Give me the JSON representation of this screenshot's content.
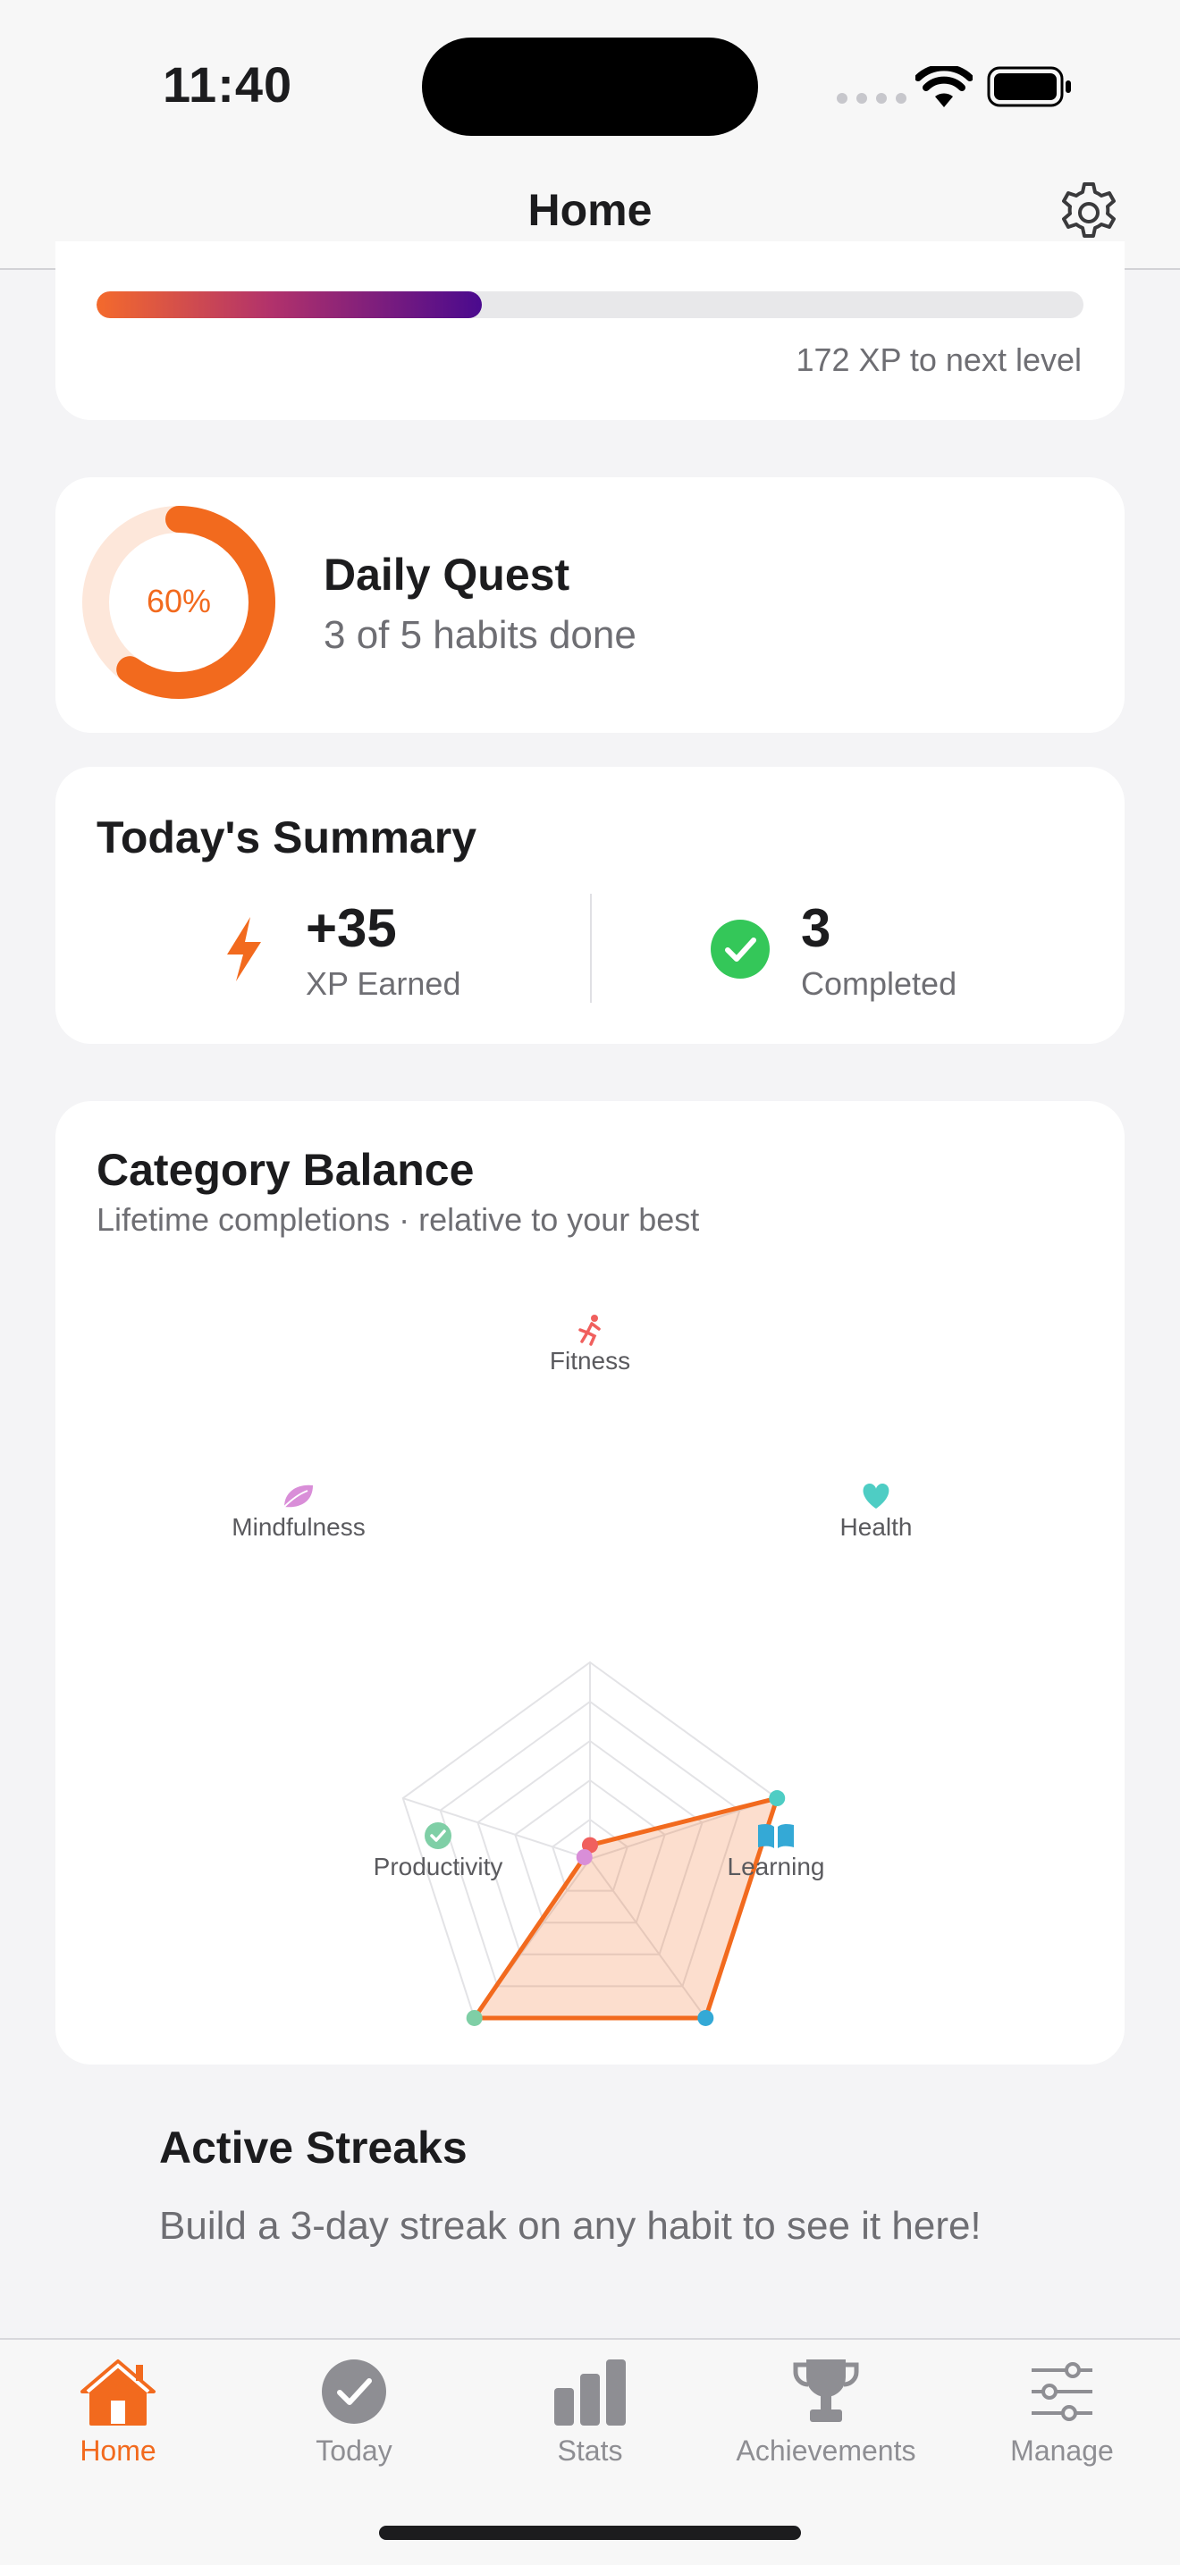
{
  "status_bar": {
    "time": "11:40"
  },
  "nav": {
    "title": "Home"
  },
  "xp": {
    "progress": 0.39,
    "next_level_text": "172 XP to next level"
  },
  "daily_quest": {
    "percent_label": "60%",
    "progress": 0.6,
    "title": "Daily Quest",
    "subtitle": "3 of 5 habits done"
  },
  "summary": {
    "title": "Today's Summary",
    "xp_value": "+35",
    "xp_label": "XP Earned",
    "completed_value": "3",
    "completed_label": "Completed"
  },
  "category_balance": {
    "title": "Category Balance",
    "subtitle": "Lifetime completions · relative to your best",
    "axes": [
      {
        "name": "Fitness",
        "icon": "running-icon",
        "color": "#F0605E",
        "value": 0.07
      },
      {
        "name": "Health",
        "icon": "heart-icon",
        "color": "#4ECDC4",
        "value": 1.0
      },
      {
        "name": "Learning",
        "icon": "book-icon",
        "color": "#34A9D6",
        "value": 1.0
      },
      {
        "name": "Productivity",
        "icon": "check-circle-icon",
        "color": "#7FCFA6",
        "value": 1.0
      },
      {
        "name": "Mindfulness",
        "icon": "leaf-icon",
        "color": "#D98ED8",
        "value": 0.03
      }
    ],
    "accent": "#F26A1E"
  },
  "streaks": {
    "title": "Active Streaks",
    "message": "Build a 3-day streak on any habit to see it here!"
  },
  "tabs": [
    {
      "label": "Home",
      "icon": "house-icon",
      "active": true
    },
    {
      "label": "Today",
      "icon": "check-circle-icon",
      "active": false
    },
    {
      "label": "Stats",
      "icon": "bar-chart-icon",
      "active": false
    },
    {
      "label": "Achievements",
      "icon": "trophy-icon",
      "active": false
    },
    {
      "label": "Manage",
      "icon": "sliders-icon",
      "active": false
    }
  ]
}
